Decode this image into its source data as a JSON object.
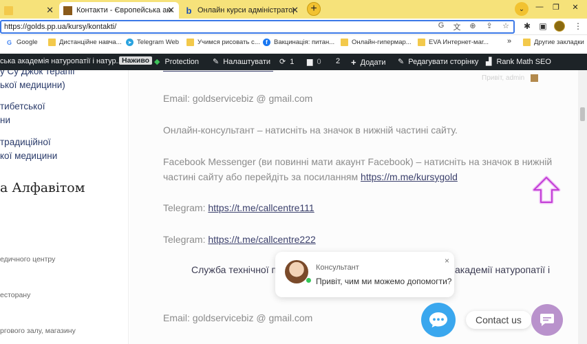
{
  "browser": {
    "tabs": [
      {
        "title": "",
        "favicon": "yellow-page"
      },
      {
        "title": "Контакти - Європейська академ",
        "favicon": "academy-logo",
        "active": true
      },
      {
        "title": "Онлайн курси адміністратора са",
        "favicon": "b-logo"
      }
    ],
    "new_tab": "+",
    "tab_search": "⌄",
    "window_controls": [
      "—",
      "❐",
      "✕"
    ],
    "url": "https://golds.pp.ua/kursy/kontakti/"
  },
  "bookmarks": [
    {
      "label": "Google",
      "icon": "google-icon"
    },
    {
      "label": "Дистанційне навча...",
      "icon": "folder-icon"
    },
    {
      "label": "Telegram Web",
      "icon": "telegram-icon"
    },
    {
      "label": "Учимся рисовать с...",
      "icon": "folder-icon"
    },
    {
      "label": "Вакцинація: питан...",
      "icon": "facebook-icon"
    },
    {
      "label": "Онлайн-гипермар...",
      "icon": "folder-icon"
    },
    {
      "label": "EVA Интернет-маг...",
      "icon": "folder-icon"
    },
    {
      "label": "»",
      "icon": ""
    },
    {
      "label": "Другие закладки",
      "icon": "folder-icon"
    }
  ],
  "adminbar": {
    "site_title": "ська академія натуропатії і натур...",
    "live_badge": "Наживо",
    "protection": "Protection",
    "settings": "Налаштувати",
    "updates_count": "1",
    "comments_count": "0",
    "pending_count": "2",
    "add_new": "Додати",
    "edit_page": "Редагувати сторінку",
    "rank_math": "Rank Math SEO"
  },
  "sidebar": {
    "links": [
      "у Су Джок терапії",
      "ької медицини)",
      "тибетської",
      "ни",
      "традиційної",
      "кої медицини"
    ],
    "heading": "а Алфавітом",
    "small_items": [
      "едичного центру",
      "есторану",
      "ргового залу, магазину"
    ]
  },
  "content": {
    "faded_greeting": "Привіт, admin",
    "email_1": "Email: goldservicebiz @ gmail.com",
    "consultant_line": "Онлайн-консультант – натисніть на значок в нижній частині сайту.",
    "fb_line_1": "Facebook Messenger (ви повинні мати акаунт Facebook) – натисніть на значок в нижній",
    "fb_line_2_prefix": "частині сайту або перейдіть за посиланням ",
    "fb_link": "https://m.me/kursygold",
    "telegram_label": "Telegram: ",
    "telegram_link_1": "https://t.me/callcentre111",
    "telegram_link_2": "https://t.me/callcentre222",
    "support_line_start": "Служба технічної п",
    "support_line_end": "академії натуропатії і",
    "email_2": "Email: goldservicebiz @ gmail.com"
  },
  "chat": {
    "name": "Консультант",
    "message": "Привіт, чим ми можемо допомогти?",
    "close": "×",
    "contact_us": "Contact us"
  },
  "colors": {
    "tab_strip": "#f6e27a",
    "admin_bar": "#1d2327",
    "link": "#3a3f6b",
    "messenger": "#3aa7ee",
    "contact": "#b992cc",
    "arrow": "#d86ee6"
  }
}
